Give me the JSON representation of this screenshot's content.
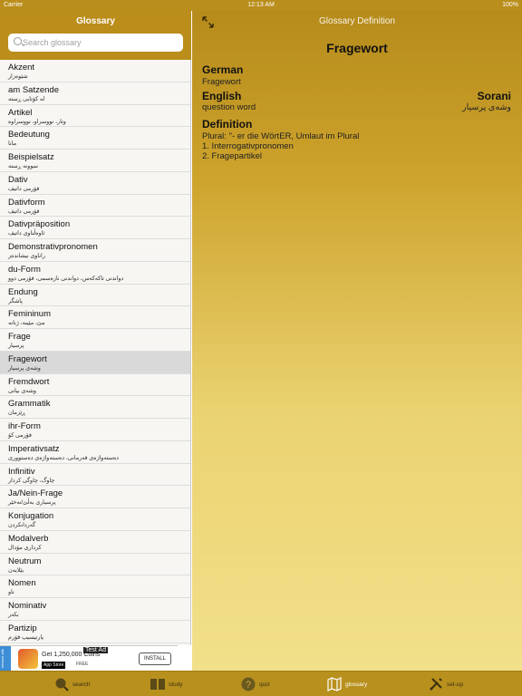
{
  "status_bar": {
    "carrier": "Carrier",
    "time": "12:13 AM",
    "battery": "100%"
  },
  "left_panel": {
    "title": "Glossary",
    "search_placeholder": "Search glossary",
    "items": [
      {
        "de": "Akzent",
        "ku": "شێوەزار"
      },
      {
        "de": "am Satzende",
        "ku": "لە کۆتایی ڕستە"
      },
      {
        "de": "Artikel",
        "ku": "وتار، نووسراو، نووسراوە"
      },
      {
        "de": "Bedeutung",
        "ku": "مانا"
      },
      {
        "de": "Beispielsatz",
        "ku": "نموونە ڕستە"
      },
      {
        "de": "Dativ",
        "ku": "فۆرمی داتیف"
      },
      {
        "de": "Dativform",
        "ku": "فۆرمی داتیف"
      },
      {
        "de": "Dativpräposition",
        "ku": "ئاوەڵناوی داتیف"
      },
      {
        "de": "Demonstrativpronomen",
        "ku": "راناوی نیشاندەر"
      },
      {
        "de": "du-Form",
        "ku": "دواندنی تاکەکەس، دواندنی نازەسمی، فۆرمی دوو"
      },
      {
        "de": "Endung",
        "ku": "پاشگر"
      },
      {
        "de": "Femininum",
        "ku": "مێ، مێینە، ژنانە"
      },
      {
        "de": "Frage",
        "ku": "پرسیار"
      },
      {
        "de": "Fragewort",
        "ku": "وشەی پرسیار"
      },
      {
        "de": "Fremdwort",
        "ku": "وشەی بیانی"
      },
      {
        "de": "Grammatik",
        "ku": "ڕێزمان"
      },
      {
        "de": "ihr-Form",
        "ku": "فۆرمی کۆ"
      },
      {
        "de": "Imperativsatz",
        "ku": "دەستەواژەی فەرمانی، دەستەواژەی دەستووری"
      },
      {
        "de": "Infinitiv",
        "ku": "چاوگ، چاوگی کردار"
      },
      {
        "de": "Ja/Nein-Frage",
        "ku": "پرسیاری بەڵێ/نەخێر"
      },
      {
        "de": "Konjugation",
        "ku": "گەردانکردن"
      },
      {
        "de": "Modalverb",
        "ku": "کرداری مۆدال"
      },
      {
        "de": "Neutrum",
        "ku": "بێلایەن"
      },
      {
        "de": "Nomen",
        "ku": "ناو"
      },
      {
        "de": "Nominativ",
        "ku": "بکەر"
      },
      {
        "de": "Partizip",
        "ku": "پارتیسیپ فۆرم"
      }
    ],
    "selected_index": 13
  },
  "ad": {
    "side_text": "remove ads",
    "tag": "Test Ad",
    "headline": "Get 1,250,000 Coins",
    "store": "App Store",
    "price": "FREE",
    "install": "INSTALL"
  },
  "detail": {
    "header_title": "Glossary Definition",
    "word": "Fragewort",
    "german_label": "German",
    "german_value": "Fragewort",
    "english_label": "English",
    "english_value": "question word",
    "sorani_label": "Sorani",
    "sorani_value": "وشەی پرسیار",
    "definition_label": "Definition",
    "definition_lines": [
      "Plural: \"- er die WörtER, Umlaut im Plural",
      "1. Interrogativpronomen",
      "2. Fragepartikel"
    ]
  },
  "tabs": [
    {
      "label": "search",
      "icon": "search-icon"
    },
    {
      "label": "study",
      "icon": "book-icon"
    },
    {
      "label": "quiz",
      "icon": "question-icon"
    },
    {
      "label": "glossary",
      "icon": "map-icon"
    },
    {
      "label": "set-up",
      "icon": "tools-icon"
    }
  ],
  "colors": {
    "accent": "#b8901d",
    "selected_row": "#d9d9d9"
  }
}
